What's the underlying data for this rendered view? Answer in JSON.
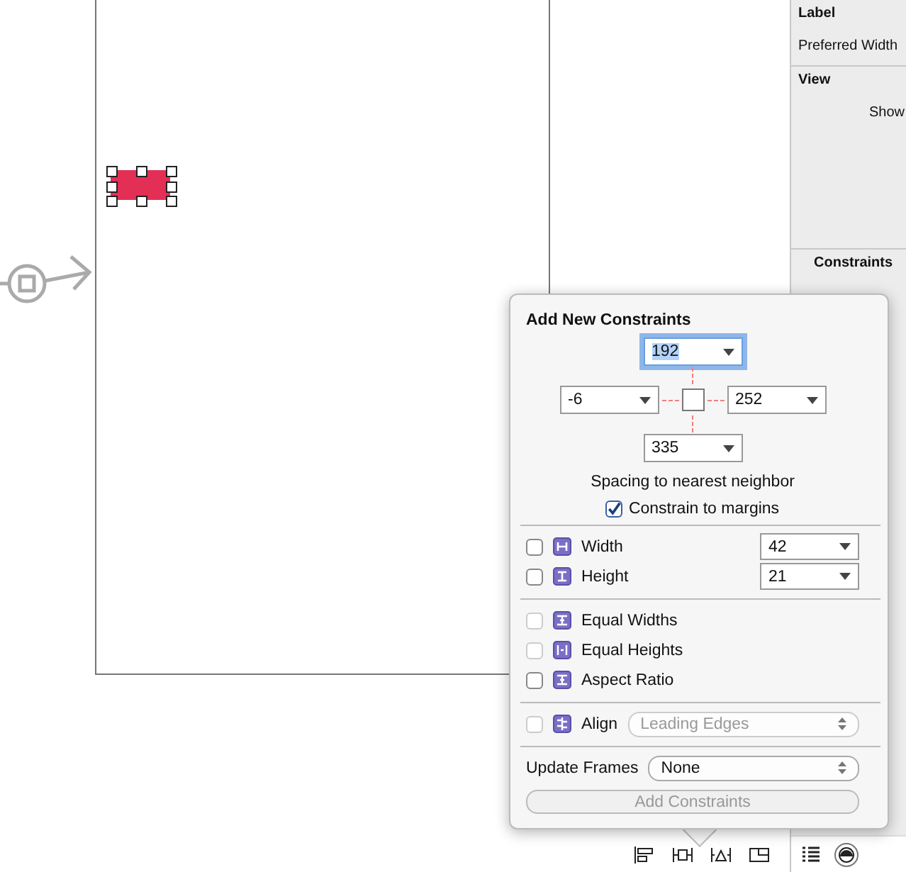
{
  "inspector": {
    "label_section": {
      "title": "Label",
      "field_label": "Preferred Width"
    },
    "view_section": {
      "title": "View",
      "field_label": "Show"
    },
    "constraints_section": {
      "title": "Constraints"
    }
  },
  "popover": {
    "title": "Add New Constraints",
    "spacing": {
      "top": {
        "value": "192",
        "focused": true
      },
      "left": {
        "value": "-6",
        "focused": false
      },
      "right": {
        "value": "252",
        "focused": false
      },
      "bottom": {
        "value": "335",
        "focused": false
      }
    },
    "caption": "Spacing to nearest neighbor",
    "constrain_to_margins": {
      "label": "Constrain to margins",
      "checked": true
    },
    "size_rows": [
      {
        "label": "Width",
        "checked": false,
        "value": "42",
        "kind": "width"
      },
      {
        "label": "Height",
        "checked": false,
        "value": "21",
        "kind": "height"
      }
    ],
    "relation_rows": [
      {
        "label": "Equal Widths",
        "checked": false,
        "disabled": true,
        "kind": "equal-widths"
      },
      {
        "label": "Equal Heights",
        "checked": false,
        "disabled": true,
        "kind": "equal-heights"
      },
      {
        "label": "Aspect Ratio",
        "checked": false,
        "disabled": false,
        "kind": "aspect"
      }
    ],
    "align": {
      "label": "Align",
      "value": "Leading Edges",
      "checked": false,
      "disabled": true
    },
    "update_frames": {
      "label": "Update Frames",
      "value": "None"
    },
    "add_button": {
      "label": "Add Constraints",
      "disabled": true
    }
  }
}
